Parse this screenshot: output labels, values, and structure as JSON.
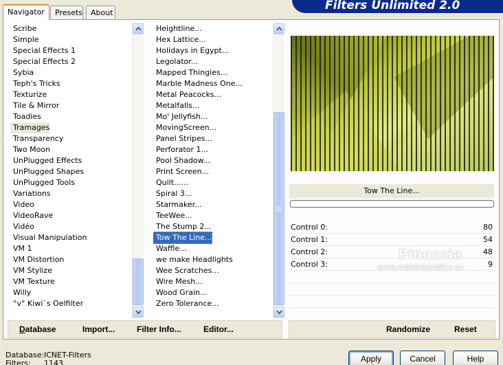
{
  "tabs": [
    "Navigator",
    "Presets",
    "About"
  ],
  "app_title": "Filters Unlimited 2.0",
  "categories": [
    "Scribe",
    "Simple",
    "Special Effects 1",
    "Special Effects 2",
    "Sybia",
    "Teph's Tricks",
    "Texturize",
    "Tile & Mirror",
    "Toadies",
    "Tramages",
    "Transparency",
    "Two Moon",
    "UnPlugged Effects",
    "UnPlugged Shapes",
    "UnPlugged Tools",
    "Variations",
    "Video",
    "VideoRave",
    "Vidéo",
    "Visual Manipulation",
    "VM 1",
    "VM Distortion",
    "VM Stylize",
    "VM Texture",
    "Willy",
    "°v° Kiwi`s Oelfilter"
  ],
  "selected_category": "Tramages",
  "filters": [
    "Heightline...",
    "Hex Lattice...",
    "Holidays in Egypt...",
    "Legolator...",
    "Mapped Thingies...",
    "Marble Madness One...",
    "Metal Peacocks...",
    "Metalfalls...",
    "Mo' Jellyfish...",
    "MovingScreen...",
    "Panel Stripes...",
    "Perforator 1...",
    "Pool Shadow...",
    "Print Screen...",
    "Quilt......",
    "Spiral 3...",
    "Starmaker...",
    "TeeWee...",
    "The Stump 2...",
    "Tow The Line...",
    "Waffle...",
    "we make Headlights",
    "Wee Scratches...",
    "Wire Mesh...",
    "Wood Grain...",
    "Zero Tolerance..."
  ],
  "selected_filter": "Tow The Line...",
  "left_buttons": {
    "database": "Database",
    "import": "Import...",
    "filter_info": "Filter Info...",
    "editor": "Editor..."
  },
  "right_buttons": {
    "randomize": "Randomize",
    "reset": "Reset"
  },
  "filter_name": "Tow The Line...",
  "controls": [
    {
      "label": "Control 0:",
      "value": "80"
    },
    {
      "label": "Control 1:",
      "value": "54"
    },
    {
      "label": "Control 2:",
      "value": "48"
    },
    {
      "label": "Control 3:",
      "value": "9"
    }
  ],
  "watermark": {
    "name": "Pinuccia",
    "site": "www.maidiregrafica.eu"
  },
  "dialog_buttons": {
    "apply": "Apply",
    "cancel": "Cancel",
    "help": "Help"
  },
  "status": {
    "database_label": "Database:",
    "database_value": "ICNET-Filters",
    "filters_label": "Filters:",
    "filters_value": "1143"
  },
  "colors": {
    "accent": "#316ac5",
    "title_bar": "#0a2a8c",
    "preview_green": "#b9c43a"
  }
}
